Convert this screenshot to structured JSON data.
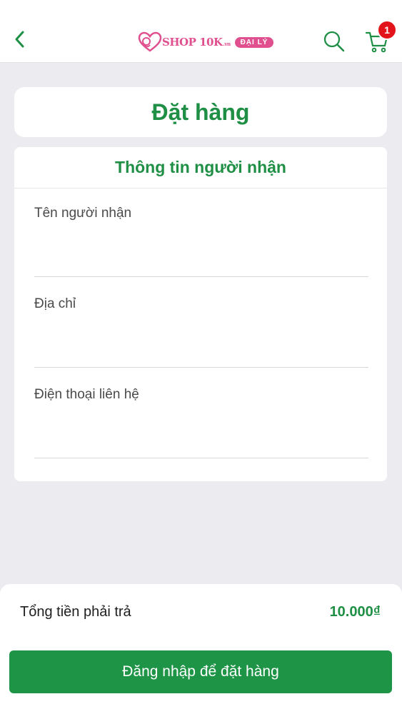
{
  "colors": {
    "accent": "#1f8f45",
    "button": "#1e9447",
    "brand_pink": "#e0508f",
    "badge_red": "#e3131b",
    "background": "#ecebef"
  },
  "header": {
    "back_icon": "chevron-left-icon",
    "logo": {
      "text": "SHOP 10K",
      "suffix": ".vn",
      "badge": "ĐẠI LÝ"
    },
    "search_icon": "search-icon",
    "cart_icon": "cart-icon",
    "cart_count": "1"
  },
  "page": {
    "title": "Đặt hàng"
  },
  "form": {
    "section_title": "Thông tin người nhận",
    "fields": [
      {
        "label": "Tên người nhận",
        "value": ""
      },
      {
        "label": "Địa chỉ",
        "value": ""
      },
      {
        "label": "Điện thoại liên hệ",
        "value": ""
      }
    ]
  },
  "summary": {
    "total_label": "Tổng tiền phải trả",
    "total_value": "10.000₫",
    "order_button": "Đăng nhập để đặt hàng"
  }
}
